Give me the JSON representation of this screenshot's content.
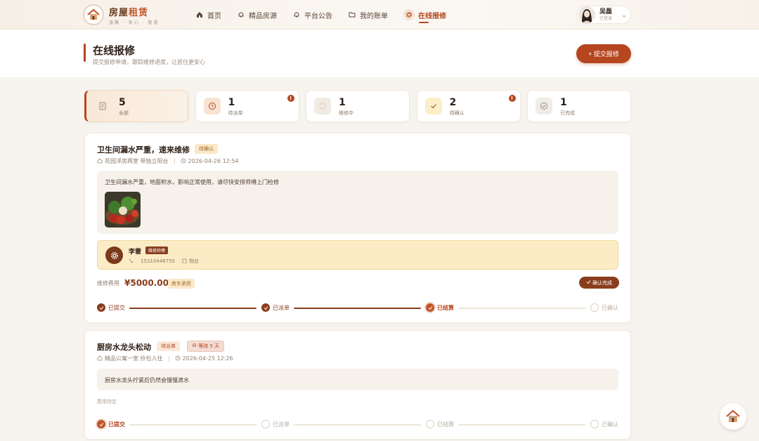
{
  "header": {
    "logo_title_a": "房屋",
    "logo_title_b": "租赁",
    "logo_sub": "温馨 · 安心 · 智慧",
    "nav": [
      {
        "label": "首页",
        "icon": "home-icon"
      },
      {
        "label": "精品房源",
        "icon": "bell-outline-icon"
      },
      {
        "label": "平台公告",
        "icon": "bell-icon"
      },
      {
        "label": "我的账单",
        "icon": "folder-icon"
      },
      {
        "label": "在线报修",
        "icon": "gear-icon",
        "active": true
      }
    ],
    "user": {
      "name": "吴磊",
      "status": "已登录"
    }
  },
  "page": {
    "title": "在线报修",
    "subtitle": "提交报修申请，跟踪维修进度，让居住更安心",
    "submit_label": "+ 提交报修"
  },
  "stats": [
    {
      "count": "5",
      "label": "全部",
      "icon": "document-icon",
      "active": true
    },
    {
      "count": "1",
      "label": "待派单",
      "icon": "clock-icon",
      "alert": "!"
    },
    {
      "count": "1",
      "label": "维修中",
      "icon": "spinner-icon"
    },
    {
      "count": "2",
      "label": "待确认",
      "icon": "check-icon",
      "alert": "!"
    },
    {
      "count": "1",
      "label": "已完成",
      "icon": "check-circle-icon"
    }
  ],
  "orders": [
    {
      "title": "卫生间漏水严重，速来维修",
      "status": "待确认",
      "property": "花园洋房两室 带独立阳台",
      "time": "2026-04-26 12:54",
      "description": "卫生间漏水严重，地面积水，影响正常使用，请尽快安排师傅上门检修",
      "worker": {
        "name": "李雷",
        "role": "维修师傅",
        "phone": "15310448755",
        "dept": "物业"
      },
      "fee_label": "维修费用",
      "fee": "¥5000.00",
      "fee_payer": "房东承担",
      "confirm_label": "确认完成",
      "steps": [
        "已提交",
        "已派单",
        "已结算",
        "已确认"
      ],
      "progress_step": 3
    },
    {
      "title": "厨房水龙头松动",
      "status": "待派单",
      "wait": "等待 5 天",
      "property": "精品公寓一室 拎包入住",
      "time": "2026-04-25 12:26",
      "description": "厨房水龙头拧紧后仍然会慢慢滴水",
      "fee_label": "费用待定",
      "steps": [
        "已提交",
        "已派单",
        "已结算",
        "已确认"
      ],
      "progress_step": 1
    }
  ],
  "colors": {
    "accent": "#b5461f",
    "brown": "#8a3d1d",
    "bg": "#f7f4ef"
  }
}
